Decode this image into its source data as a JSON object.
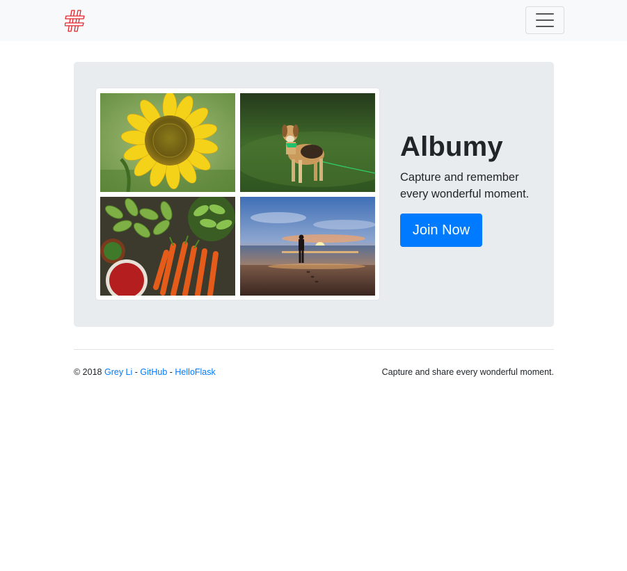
{
  "navbar": {
    "logo_icon": "hash-logo-icon",
    "menu_icon": "hamburger-menu-icon",
    "colors": {
      "background": "#f8f9fa",
      "logo": "#e0242b"
    }
  },
  "hero": {
    "title": "Albumy",
    "lead": "Capture and remember every wonderful moment.",
    "button_label": "Join Now",
    "photos": [
      "sunflower-photo",
      "dog-on-grass-photo",
      "vegetables-photo",
      "beach-sunset-photo"
    ],
    "colors": {
      "background": "#e9ecef",
      "button": "#007bff"
    }
  },
  "footer": {
    "copyright": "© 2018",
    "author_link": "Grey Li",
    "sep1": " - ",
    "github_link": "GitHub",
    "sep2": " - ",
    "helloflask_link": "HelloFlask",
    "tagline": "Capture and share every wonderful moment.",
    "colors": {
      "link": "#007bff"
    }
  }
}
